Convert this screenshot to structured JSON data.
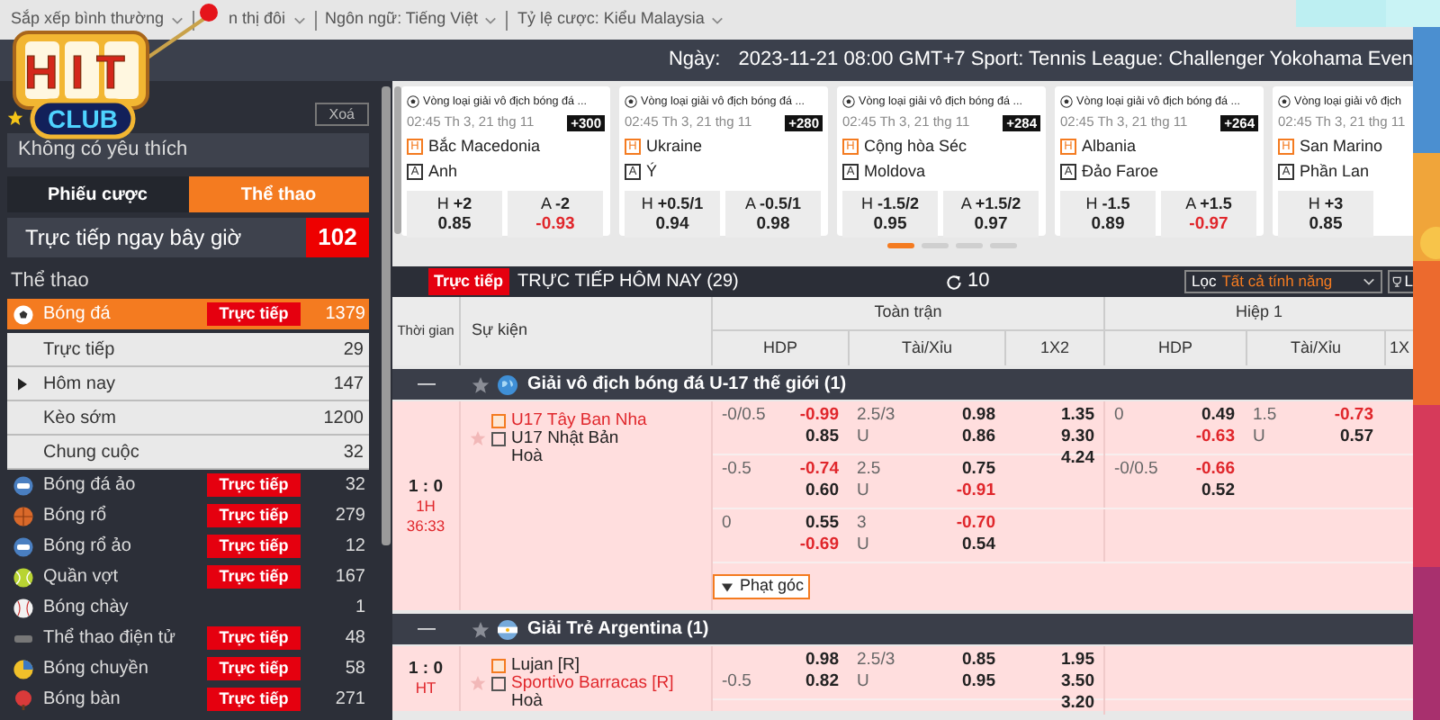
{
  "top_bar": {
    "items": [
      "Sắp xếp bình thường",
      "n thị đôi",
      "Ngôn ngữ: Tiếng Việt",
      "Tỷ lệ cược: Kiểu Malaysia"
    ]
  },
  "logo": {
    "text_top": "HIT",
    "text_bottom": "CLUB"
  },
  "header": {
    "date_label": "Ngày:",
    "ticker": "2023-11-21 08:00 GMT+7 Sport: Tennis League: Challenger Yokohama Even"
  },
  "sidebar": {
    "clear_button": "Xoá",
    "favorites_empty": "Không có yêu thích",
    "tabs": [
      {
        "label": "Phiếu cược",
        "selected": false
      },
      {
        "label": "Thể thao",
        "selected": true
      }
    ],
    "live_now": {
      "label": "Trực tiếp ngay bây giờ",
      "count": "102"
    },
    "section_title": "Thể thao",
    "sports": [
      {
        "name": "Bóng đá",
        "kind": "soccer",
        "live_label": "Trực tiếp",
        "count": "1379",
        "selected": true,
        "children": [
          {
            "name": "Trực tiếp",
            "count": "29",
            "kind": "plain"
          },
          {
            "name": "Hôm nay",
            "count": "147",
            "kind": "expandable"
          },
          {
            "name": "Kèo sớm",
            "count": "1200",
            "kind": "plain"
          },
          {
            "name": "Chung cuộc",
            "count": "32",
            "kind": "plain"
          }
        ]
      },
      {
        "name": "Bóng đá ảo",
        "kind": "virtual",
        "live_label": "Trực tiếp",
        "count": "32",
        "selected": false
      },
      {
        "name": "Bóng rổ",
        "kind": "basketball",
        "live_label": "Trực tiếp",
        "count": "279",
        "selected": false
      },
      {
        "name": "Bóng rổ ảo",
        "kind": "virtual",
        "live_label": "Trực tiếp",
        "count": "12",
        "selected": false
      },
      {
        "name": "Quần vợt",
        "kind": "tennis",
        "live_label": "Trực tiếp",
        "count": "167",
        "selected": false
      },
      {
        "name": "Bóng chày",
        "kind": "baseball",
        "count": "1",
        "selected": false
      },
      {
        "name": "Thể thao điện tử",
        "kind": "esports",
        "live_label": "Trực tiếp",
        "count": "48",
        "selected": false
      },
      {
        "name": "Bóng chuyền",
        "kind": "volleyball",
        "live_label": "Trực tiếp",
        "count": "58",
        "selected": false
      },
      {
        "name": "Bóng bàn",
        "kind": "table_tennis",
        "live_label": "Trực tiếp",
        "count": "271",
        "selected": false
      }
    ]
  },
  "carousel": {
    "cards": [
      {
        "league": "Vòng loại giải vô địch bóng đá ...",
        "time": "02:45 Th 3, 21 thg 11",
        "more": "+300",
        "home_tag": "H",
        "home": "Bắc Macedonia",
        "away_tag": "A",
        "away": "Anh",
        "odds": [
          {
            "side": "H",
            "line": "+2",
            "price": "0.85",
            "negative": false
          },
          {
            "side": "A",
            "line": "-2",
            "price": "-0.93",
            "negative": true
          }
        ]
      },
      {
        "league": "Vòng loại giải vô địch bóng đá ...",
        "time": "02:45 Th 3, 21 thg 11",
        "more": "+280",
        "home_tag": "H",
        "home": "Ukraine",
        "away_tag": "A",
        "away": "Ý",
        "odds": [
          {
            "side": "H",
            "line": "+0.5/1",
            "price": "0.94",
            "negative": false
          },
          {
            "side": "A",
            "line": "-0.5/1",
            "price": "0.98",
            "negative": false
          }
        ]
      },
      {
        "league": "Vòng loại giải vô địch bóng đá ...",
        "time": "02:45 Th 3, 21 thg 11",
        "more": "+284",
        "home_tag": "H",
        "home": "Cộng hòa Séc",
        "away_tag": "A",
        "away": "Moldova",
        "odds": [
          {
            "side": "H",
            "line": "-1.5/2",
            "price": "0.95",
            "negative": false
          },
          {
            "side": "A",
            "line": "+1.5/2",
            "price": "0.97",
            "negative": false
          }
        ]
      },
      {
        "league": "Vòng loại giải vô địch bóng đá ...",
        "time": "02:45 Th 3, 21 thg 11",
        "more": "+264",
        "home_tag": "H",
        "home": "Albania",
        "away_tag": "A",
        "away": "Đảo Faroe",
        "odds": [
          {
            "side": "H",
            "line": "-1.5",
            "price": "0.89",
            "negative": false
          },
          {
            "side": "A",
            "line": "+1.5",
            "price": "-0.97",
            "negative": true
          }
        ]
      },
      {
        "league": "Vòng loại giải vô địch",
        "time": "02:45 Th 3, 21 thg 11",
        "home_tag": "H",
        "home": "San Marino",
        "away_tag": "A",
        "away": "Phần Lan",
        "odds": [
          {
            "side": "H",
            "line": "+3",
            "price": "0.85",
            "negative": false
          }
        ]
      }
    ],
    "dots": [
      {
        "selected": true
      },
      {
        "selected": false
      },
      {
        "selected": false
      },
      {
        "selected": false
      }
    ]
  },
  "table": {
    "live_badge": "Trực tiếp",
    "title": "TRỰC TIẾP HÔM NAY (29)",
    "refresh_count": "10",
    "filter_label": "Lọc",
    "filter_value": "Tất cả tính năng",
    "league_button": "L",
    "columns": {
      "time": "Thời gian",
      "event": "Sự kiện",
      "groups": [
        {
          "label": "Toàn trận",
          "columns": [
            "HDP",
            "Tài/Xỉu",
            "1X2"
          ]
        },
        {
          "label": "Hiệp 1",
          "columns": [
            "HDP",
            "Tài/Xỉu",
            "1X"
          ]
        }
      ]
    },
    "leagues": [
      {
        "collapse_sign": "—",
        "name": "Giải vô địch bóng đá U-17 thế giới (1)",
        "kind": "globe",
        "matches": [
          {
            "score": "1 : 0",
            "period": "1H",
            "clock": "36:33",
            "home": {
              "name": "U17 Tây Ban Nha",
              "favorite": true
            },
            "away": {
              "name": "U17 Nhật Bản",
              "favorite": false
            },
            "draw": "Hoà",
            "extra_button": "Phạt góc",
            "lines": [
              {
                "ft_hdp": {
                  "home": {
                    "line": "-0/0.5",
                    "value": "-0.99",
                    "negative": true
                  },
                  "away": {
                    "value": "0.85",
                    "negative": false
                  }
                },
                "ft_ou": {
                  "line": "2.5/3",
                  "under": "U",
                  "odds": [
                    {
                      "value": "0.98",
                      "negative": false
                    },
                    {
                      "value": "0.86",
                      "negative": false
                    }
                  ]
                },
                "ft_1x2": [
                  "1.35",
                  "9.30",
                  "4.24"
                ],
                "h1_hdp": {
                  "home": {
                    "line": "0",
                    "value": "0.49",
                    "negative": false
                  },
                  "away": {
                    "value": "-0.63",
                    "negative": true
                  }
                },
                "h1_ou": {
                  "line": "1.5",
                  "under": "U",
                  "odds": [
                    {
                      "value": "-0.73",
                      "negative": true
                    },
                    {
                      "value": "0.57",
                      "negative": false
                    }
                  ]
                }
              },
              {
                "ft_hdp": {
                  "home": {
                    "line": "-0.5",
                    "value": "-0.74",
                    "negative": true
                  },
                  "away": {
                    "value": "0.60",
                    "negative": false
                  }
                },
                "ft_ou": {
                  "line": "2.5",
                  "under": "U",
                  "odds": [
                    {
                      "value": "0.75",
                      "negative": false
                    },
                    {
                      "value": "-0.91",
                      "negative": true
                    }
                  ]
                },
                "h1_hdp": {
                  "home": {
                    "line": "-0/0.5",
                    "value": "-0.66",
                    "negative": true
                  },
                  "away": {
                    "value": "0.52",
                    "negative": false
                  }
                }
              },
              {
                "ft_hdp": {
                  "home": {
                    "line": "0",
                    "value": "0.55",
                    "negative": false
                  },
                  "away": {
                    "value": "-0.69",
                    "negative": true
                  }
                },
                "ft_ou": {
                  "line": "3",
                  "under": "U",
                  "odds": [
                    {
                      "value": "-0.70",
                      "negative": true
                    },
                    {
                      "value": "0.54",
                      "negative": false
                    }
                  ]
                }
              }
            ]
          }
        ]
      },
      {
        "collapse_sign": "—",
        "name": "Giải Trẻ Argentina (1)",
        "kind": "argentina",
        "matches": [
          {
            "score": "1 : 0",
            "period": "HT",
            "home": {
              "name": "Lujan [R]",
              "favorite": false
            },
            "away": {
              "name": "Sportivo Barracas [R]",
              "favorite": true
            },
            "draw": "Hoà",
            "lines": [
              {
                "ft_hdp": {
                  "home": {
                    "value": "0.98",
                    "negative": false
                  },
                  "away": {
                    "line": "-0.5",
                    "value": "0.82",
                    "negative": false
                  }
                },
                "ft_ou": {
                  "line": "2.5/3",
                  "under": "U",
                  "odds": [
                    {
                      "value": "0.85",
                      "negative": false
                    },
                    {
                      "value": "0.95",
                      "negative": false
                    }
                  ]
                },
                "ft_1x2": [
                  "1.95",
                  "3.50",
                  "3.20"
                ]
              }
            ]
          }
        ]
      }
    ]
  }
}
